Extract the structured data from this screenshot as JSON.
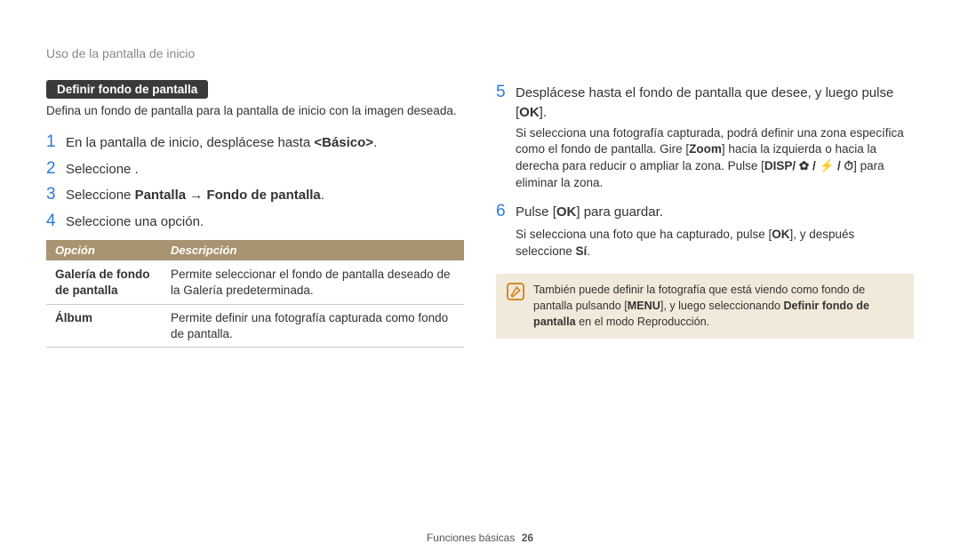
{
  "breadcrumb": "Uso de la pantalla de inicio",
  "pill_label": "Definir fondo de pantalla",
  "intro": "Defina un fondo de pantalla para la pantalla de inicio con la imagen deseada.",
  "steps_left": [
    {
      "n": "1",
      "text_before": "En la pantalla de inicio, desplácese hasta ",
      "bold": "<Básico>",
      "text_after": "."
    },
    {
      "n": "2",
      "text_before": "Seleccione ",
      "bold": "",
      "text_after": " ."
    },
    {
      "n": "3",
      "text_before": "Seleccione ",
      "bold": "Pantalla",
      "text_after": "  →  ",
      "bold2": "Fondo de pantalla",
      "text_after2": "."
    },
    {
      "n": "4",
      "text_before": "Seleccione una opción.",
      "bold": "",
      "text_after": ""
    }
  ],
  "table": {
    "headers": [
      "Opción",
      "Descripción"
    ],
    "rows": [
      [
        "Galería de fondo de pantalla",
        "Permite seleccionar el fondo de pantalla deseado de la Galería predeterminada."
      ],
      [
        "Álbum",
        "Permite definir una fotografía capturada como fondo de pantalla."
      ]
    ]
  },
  "steps_right": [
    {
      "n": "5",
      "text": "Desplácese hasta el fondo de pantalla que desee, y luego pulse [",
      "icon_after": "OK",
      "text_after": "].",
      "sub_pre": "Si selecciona una fotografía capturada, podrá definir una zona específica como el fondo de pantalla. Gire [",
      "sub_b1": "Zoom",
      "sub_mid": "] hacia la izquierda o hacia la derecha para reducir o ampliar la zona. Pulse [",
      "sub_icons": "DISP/ ✿ / ⚡ / ⏱",
      "sub_post": "] para eliminar la zona."
    },
    {
      "n": "6",
      "text": "Pulse [",
      "icon_after": "OK",
      "text_after": "] para guardar.",
      "sub_pre": "Si selecciona una foto que ha capturado, pulse [",
      "sub_b1": "OK",
      "sub_mid": "], y después seleccione ",
      "sub_b2": "Sí",
      "sub_post": "."
    }
  ],
  "note": {
    "pre": "También puede definir la fotografía que está viendo como fondo de pantalla pulsando [",
    "b1": "MENU",
    "mid": "], y luego seleccionando ",
    "b2": "Definir fondo de pantalla",
    "post": " en el modo Reproducción."
  },
  "footer": {
    "section": "Funciones básicas",
    "page": "26"
  },
  "chart_data": {
    "type": "table",
    "title": "Opciones de fondo de pantalla",
    "headers": [
      "Opción",
      "Descripción"
    ],
    "rows": [
      [
        "Galería de fondo de pantalla",
        "Permite seleccionar el fondo de pantalla deseado de la Galería predeterminada."
      ],
      [
        "Álbum",
        "Permite definir una fotografía capturada como fondo de pantalla."
      ]
    ]
  }
}
